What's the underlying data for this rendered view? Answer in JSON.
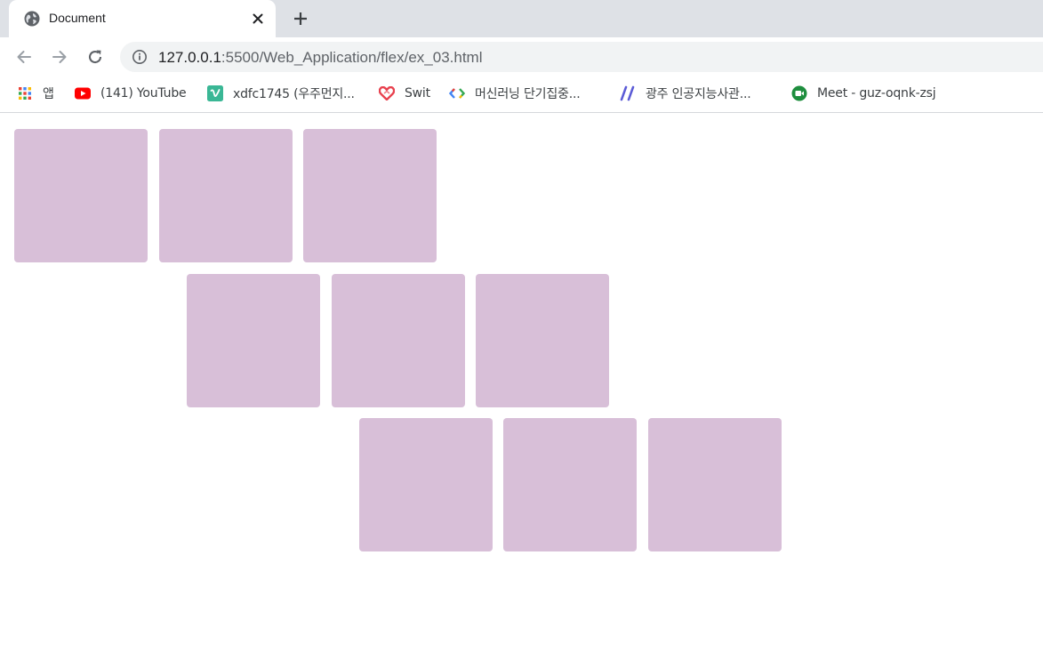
{
  "browser": {
    "tab": {
      "title": "Document",
      "favicon": "globe-icon"
    },
    "url": {
      "host": "127.0.0.1",
      "rest": ":5500/Web_Application/flex/ex_03.html"
    },
    "bookmarks": [
      {
        "label": "앱",
        "icon": "apps-grid-icon"
      },
      {
        "label": "(141) YouTube",
        "icon": "youtube-icon"
      },
      {
        "label": "xdfc1745 (우주먼지...",
        "icon": "vimeo-icon"
      },
      {
        "label": "Swit",
        "icon": "swit-heart-icon"
      },
      {
        "label": "머신러닝 단기집중...",
        "icon": "google-dev-icon"
      },
      {
        "label": "광주 인공지능사관...",
        "icon": "slash-logo-icon"
      },
      {
        "label": "Meet - guz-oqnk-zsj",
        "icon": "meet-icon"
      }
    ]
  },
  "page": {
    "box_color": "#d8bfd8",
    "rows": [
      {
        "boxes": 3
      },
      {
        "boxes": 3
      },
      {
        "boxes": 3
      }
    ]
  }
}
